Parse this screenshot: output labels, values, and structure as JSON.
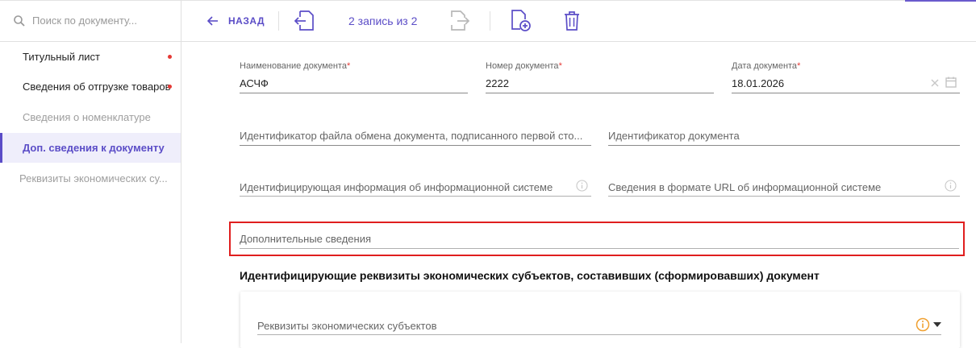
{
  "sidebar": {
    "search_placeholder": "Поиск по документу...",
    "items": [
      {
        "label": "Титульный лист"
      },
      {
        "label": "Сведения об отгрузке товаров"
      },
      {
        "label": "Сведения о номенклатуре"
      },
      {
        "label": "Доп. сведения к документу"
      },
      {
        "label": "Реквизиты экономических су..."
      }
    ]
  },
  "toolbar": {
    "back_label": "НАЗАД",
    "record_counter": "2 запись из 2"
  },
  "form": {
    "doc_name": {
      "label": "Наименование документа",
      "value": "АСЧФ"
    },
    "doc_number": {
      "label": "Номер документа",
      "value": "2222"
    },
    "doc_date": {
      "label": "Дата документа",
      "value": "18.01.2026"
    },
    "required_mark": "*",
    "exchange_file_id": {
      "placeholder": "Идентификатор файла обмена документа, подписанного первой сто..."
    },
    "doc_id": {
      "placeholder": "Идентификатор документа"
    },
    "info_system_id": {
      "placeholder": "Идентифицирующая информация об информационной системе"
    },
    "info_system_url": {
      "placeholder": "Сведения в формате URL об информационной системе"
    },
    "additional_info": {
      "placeholder": "Дополнительные сведения"
    }
  },
  "section": {
    "title": "Идентифицирующие реквизиты экономических субъектов, составивших (сформировавших) документ",
    "entities_select": {
      "placeholder": "Реквизиты экономических субъектов"
    }
  },
  "colors": {
    "accent": "#5b4dc7",
    "required": "#e53935",
    "highlight": "#e01e1e",
    "warning_icon": "#f0a030"
  }
}
